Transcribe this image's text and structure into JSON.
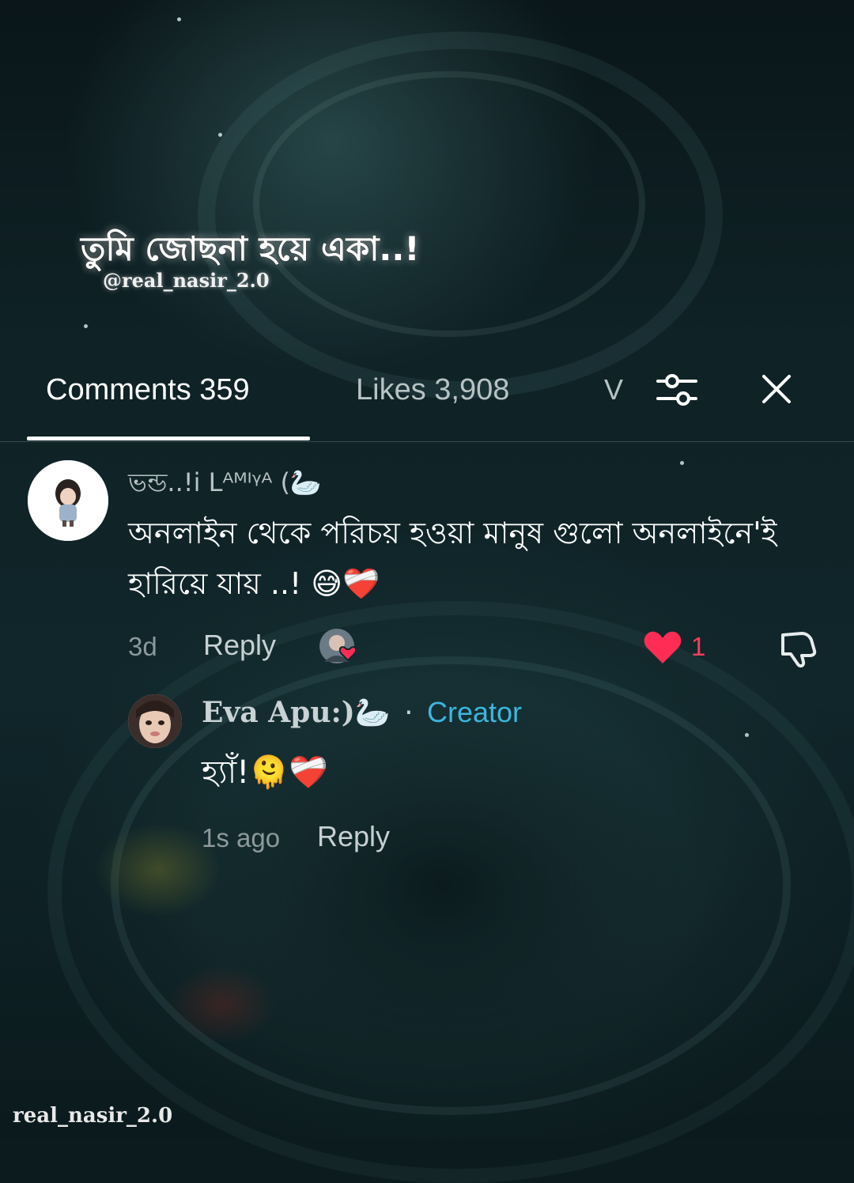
{
  "overlay": {
    "headline": "তুমি জোছনা হয়ে একা..!",
    "handle": "@real_nasir_2.0",
    "watermark": "real_nasir_2.0"
  },
  "tabs": {
    "comments": "Comments 359",
    "likes": "Likes 3,908",
    "more": "V",
    "filter_icon": "sliders-icon",
    "close_icon": "close-icon"
  },
  "comment": {
    "username": "ভন্ড..!i Lᴬᴹᴵᵞᴬ (🦢",
    "text": "অনলাইন থেকে পরিচয় হওয়া মানুষ গুলো অনলাইনে'ই হারিয়ে যায় ..! 😅❤️‍🩹",
    "time": "3d",
    "reply_label": "Reply",
    "likes": "1",
    "like_color": "#ff3b5c"
  },
  "reply": {
    "username": "Eva Apu:)🦢",
    "badge": "Creator",
    "badge_color": "#3cb6e0",
    "separator": "·",
    "text": "হ্যাঁ!🫠❤️‍🩹",
    "time": "1s ago",
    "reply_label": "Reply"
  }
}
